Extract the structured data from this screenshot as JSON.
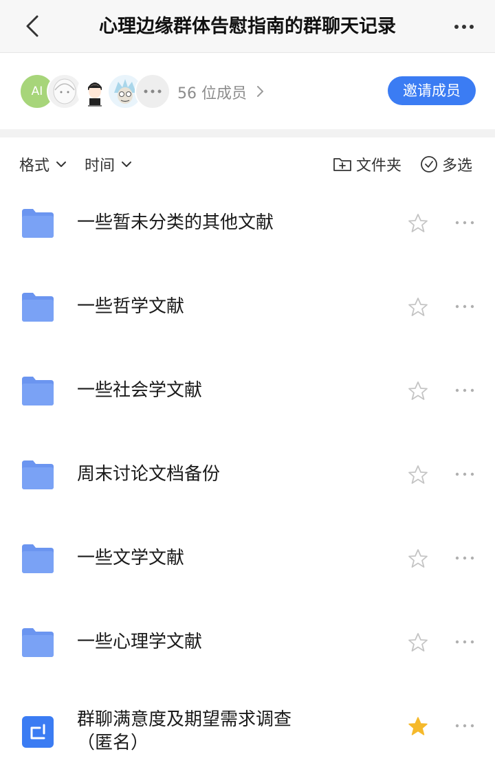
{
  "header": {
    "title": "心理边缘群体告慰指南的群聊天记录",
    "back_icon": "chevron-left-icon",
    "more_icon": "more-horizontal-icon"
  },
  "members": {
    "avatars": [
      {
        "label": "AI",
        "color": "#a7d57a"
      },
      {
        "label": "",
        "color": "#f1f1f1"
      },
      {
        "label": "",
        "color": "#ffffff"
      },
      {
        "label": "",
        "color": "#e9f4fb"
      },
      {
        "label": "",
        "color": "#eeeeee"
      }
    ],
    "count_text": "56 位成员",
    "invite_label": "邀请成员",
    "accent_color": "#3b7cf3"
  },
  "toolbar": {
    "format_label": "格式",
    "time_label": "时间",
    "new_folder_label": "文件夹",
    "multi_select_label": "多选"
  },
  "files": [
    {
      "name": "一些暂未分类的其他文献",
      "type": "folder",
      "starred": false
    },
    {
      "name": "一些哲学文献",
      "type": "folder",
      "starred": false
    },
    {
      "name": "一些社会学文献",
      "type": "folder",
      "starred": false
    },
    {
      "name": "周末讨论文档备份",
      "type": "folder",
      "starred": false
    },
    {
      "name": "一些文学文献",
      "type": "folder",
      "starred": false
    },
    {
      "name": "一些心理学文献",
      "type": "folder",
      "starred": false
    },
    {
      "name": "群聊满意度及期望需求调查（匿名）",
      "type": "form",
      "starred": true
    }
  ],
  "colors": {
    "folder": "#6b95f0",
    "star_active": "#f5b92b",
    "star_inactive": "#c4c4c4"
  }
}
